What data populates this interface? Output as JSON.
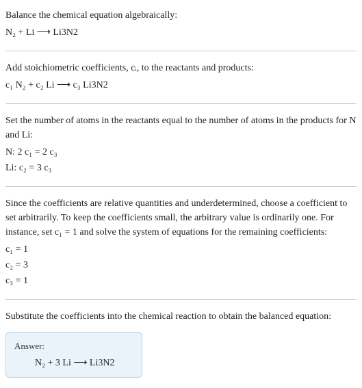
{
  "s1": {
    "title": "Balance the chemical equation algebraically:",
    "eq": "N₂ + Li ⟶ Li3N2"
  },
  "s2": {
    "title": "Add stoichiometric coefficients, cᵢ, to the reactants and products:",
    "eq": "c₁ N₂ + c₂ Li ⟶ c₃ Li3N2"
  },
  "s3": {
    "title": "Set the number of atoms in the reactants equal to the number of atoms in the products for N and Li:",
    "line1": "N:   2 c₁ = 2 c₃",
    "line2": "Li:   c₂ = 3 c₃"
  },
  "s4": {
    "title": "Since the coefficients are relative quantities and underdetermined, choose a coefficient to set arbitrarily. To keep the coefficients small, the arbitrary value is ordinarily one. For instance, set c₁ = 1 and solve the system of equations for the remaining coefficients:",
    "line1": "c₁ = 1",
    "line2": "c₂ = 3",
    "line3": "c₃ = 1"
  },
  "s5": {
    "title": "Substitute the coefficients into the chemical reaction to obtain the balanced equation:"
  },
  "answer": {
    "label": "Answer:",
    "eq": "N₂ + 3 Li ⟶ Li3N2"
  },
  "chart_data": {
    "type": "table",
    "title": "Balanced chemical equation coefficients",
    "reaction_unbalanced": "N2 + Li -> Li3N2",
    "atom_balance": [
      {
        "element": "N",
        "equation": "2 c1 = 2 c3"
      },
      {
        "element": "Li",
        "equation": "c2 = 3 c3"
      }
    ],
    "coefficients": {
      "c1": 1,
      "c2": 3,
      "c3": 1
    },
    "reaction_balanced": "N2 + 3 Li -> Li3N2"
  }
}
